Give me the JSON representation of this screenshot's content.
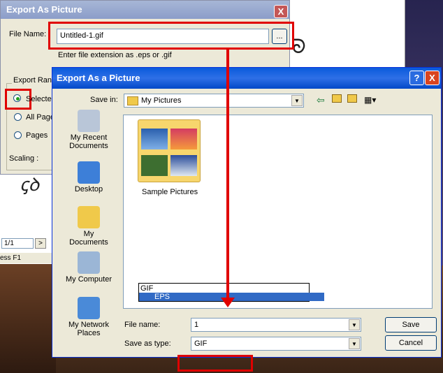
{
  "background": {
    "pager_value": "1/1",
    "pager_next": ">",
    "status_text": "ess F1"
  },
  "dialog1": {
    "title": "Export As Picture",
    "close_label": "X",
    "file_name_label": "File Name:",
    "file_name_value": "Untitled-1.gif",
    "browse_label": "...",
    "hint": "Enter file extension as .eps or .gif",
    "export_range_label": "Export Ran",
    "radio_selected": "Selecte",
    "radio_all_pages": "All Page",
    "radio_pages": "Pages",
    "scaling_label": "Scaling :"
  },
  "dialog2": {
    "title": "Export As a Picture",
    "help_label": "?",
    "close_label": "X",
    "save_in_label": "Save in:",
    "save_in_value": "My Pictures",
    "places": [
      "My Recent Documents",
      "Desktop",
      "My Documents",
      "My Computer",
      "My Network Places"
    ],
    "folder_name": "Sample Pictures",
    "file_name_label": "File name:",
    "file_name_value": "1",
    "save_as_label": "Save as type:",
    "save_as_value": "GIF",
    "save_button": "Save",
    "cancel_button": "Cancel",
    "dropdown_options": [
      "GIF",
      "EPS"
    ],
    "dropdown_selected": "EPS"
  },
  "colors": {
    "highlight": "#e00000",
    "xp_blue": "#0148c8",
    "selection": "#316ac5"
  },
  "icons": [
    "back-icon",
    "up-folder-icon",
    "new-folder-icon",
    "views-menu-icon"
  ]
}
